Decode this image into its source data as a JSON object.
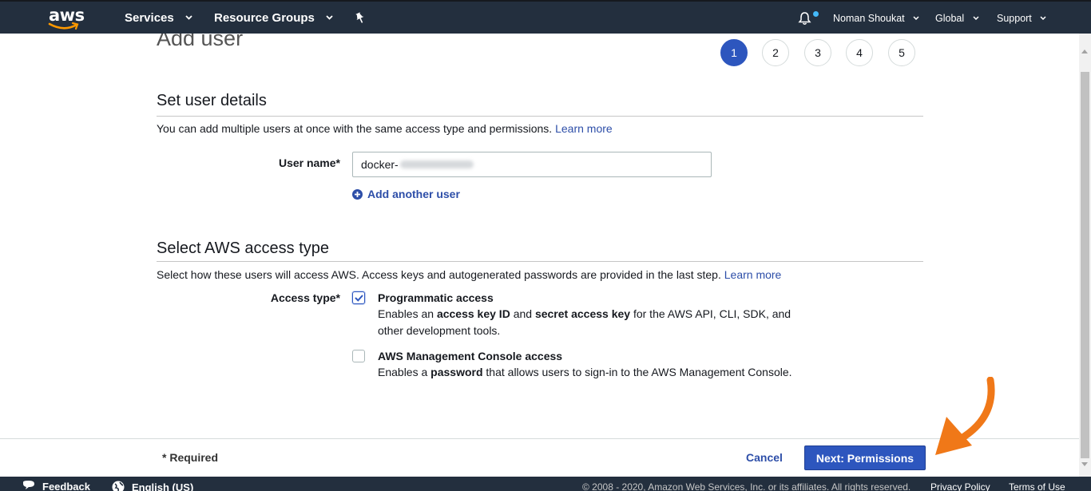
{
  "nav": {
    "logo": "aws",
    "services": "Services",
    "resource_groups": "Resource Groups",
    "user": "Noman Shoukat",
    "region": "Global",
    "support": "Support",
    "icons": [
      "bell-icon",
      "pin-icon",
      "chevron-down-icon"
    ]
  },
  "page": {
    "title": "Add user",
    "steps": [
      "1",
      "2",
      "3",
      "4",
      "5"
    ],
    "active_step": "1"
  },
  "user_details": {
    "heading": "Set user details",
    "description": "You can add multiple users at once with the same access type and permissions.",
    "learn_more": "Learn more",
    "username_label": "User name*",
    "username_value": "docker-",
    "add_another": "Add another user"
  },
  "access": {
    "heading": "Select AWS access type",
    "description": "Select how these users will access AWS. Access keys and autogenerated passwords are provided in the last step.",
    "learn_more": "Learn more",
    "label": "Access type*",
    "programmatic": {
      "title": "Programmatic access",
      "desc_1": "Enables an ",
      "bold_1": "access key ID",
      "desc_2": " and ",
      "bold_2": "secret access key",
      "desc_3": " for the AWS API, CLI, SDK, and other development tools.",
      "checked": true
    },
    "console": {
      "title": "AWS Management Console access",
      "desc_1": "Enables a ",
      "bold_1": "password",
      "desc_2": " that allows users to sign-in to the AWS Management Console.",
      "checked": false
    }
  },
  "actions": {
    "required": "* Required",
    "cancel": "Cancel",
    "next": "Next: Permissions"
  },
  "footer": {
    "feedback": "Feedback",
    "language": "English (US)",
    "copyright": "© 2008 - 2020, Amazon Web Services, Inc. or its affiliates. All rights reserved.",
    "privacy": "Privacy Policy",
    "terms": "Terms of Use"
  },
  "colors": {
    "nav_bg": "#232f3e",
    "primary": "#2d56be",
    "link": "#2d4ea8",
    "annotation_arrow": "#f07818"
  }
}
